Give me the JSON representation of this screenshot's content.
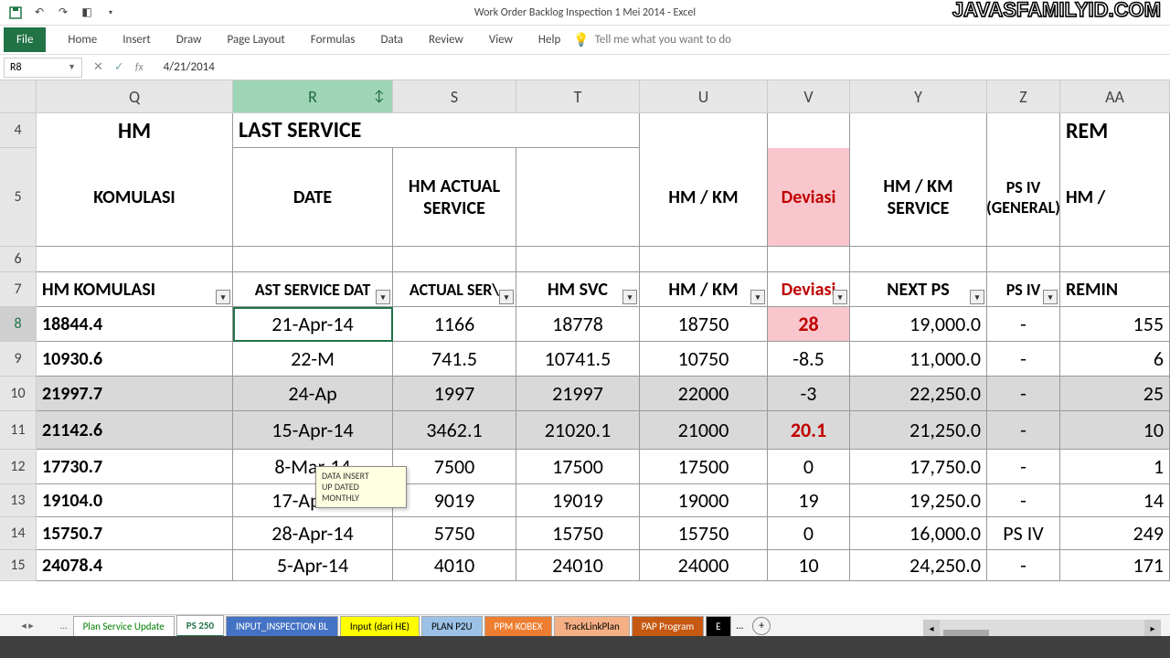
{
  "title": "Work Order Backlog  Inspection 1 Mei  2014  -  Excel",
  "watermark": "JAVASFAMILYID.COM",
  "qat": {
    "save": "save",
    "undo": "undo",
    "redo": "redo",
    "touch": "touch"
  },
  "ribbon": {
    "file": "File",
    "tabs": [
      "Home",
      "Insert",
      "Draw",
      "Page Layout",
      "Formulas",
      "Data",
      "Review",
      "View",
      "Help"
    ],
    "tell": "Tell me what you want to do"
  },
  "formula_bar": {
    "name": "R8",
    "value": "4/21/2014"
  },
  "columns": [
    "Q",
    "R",
    "S",
    "T",
    "U",
    "V",
    "Y",
    "Z",
    "AA"
  ],
  "selected_col_idx": 1,
  "row_heads": [
    "4",
    "5",
    "6",
    "7",
    "8",
    "9",
    "10",
    "11",
    "12",
    "13",
    "14",
    "15"
  ],
  "selected_row_idx": 4,
  "header1": {
    "Q": "HM",
    "R": "LAST SERVICE",
    "AA": "REM"
  },
  "header2": {
    "Q": "KOMULASI",
    "R": "DATE",
    "S": "HM ACTUAL SERVICE",
    "T": "",
    "U": "HM / KM",
    "V": "Deviasi",
    "Y": "HM / KM SERVICE",
    "Z": "PS IV (GENERAL)",
    "AA": "HM /"
  },
  "filter_row": {
    "Q": "HM KOMULASI",
    "R": "AST SERVICE DAT",
    "S": "ACTUAL SER\\",
    "T": "HM SVC",
    "U": "HM / KM",
    "V": "Deviasi",
    "Y": "NEXT PS",
    "Z": "PS IV",
    "AA": "REMIN"
  },
  "data": [
    {
      "Q": "18844.4",
      "R": "21-Apr-14",
      "S": "1166",
      "T": "18778",
      "U": "18750",
      "V": "28",
      "Vred": true,
      "Y": "19,000.0",
      "Z": "-",
      "AA": "155"
    },
    {
      "Q": "10930.6",
      "R": "22-M",
      "S": "741.5",
      "T": "10741.5",
      "U": "10750",
      "V": "-8.5",
      "Y": "11,000.0",
      "Z": "-",
      "AA": "6"
    },
    {
      "Q": "21997.7",
      "R": "24-Ap",
      "S": "1997",
      "T": "21997",
      "U": "22000",
      "V": "-3",
      "Y": "22,250.0",
      "Z": "-",
      "AA": "25",
      "gray": true
    },
    {
      "Q": "21142.6",
      "R": "15-Apr-14",
      "S": "3462.1",
      "T": "21020.1",
      "U": "21000",
      "V": "20.1",
      "Vred": true,
      "Y": "21,250.0",
      "Z": "-",
      "AA": "10",
      "gray": true
    },
    {
      "Q": "17730.7",
      "R": "8-Mar-14",
      "S": "7500",
      "T": "17500",
      "U": "17500",
      "V": "0",
      "Y": "17,750.0",
      "Z": "-",
      "AA": "1"
    },
    {
      "Q": "19104.0",
      "R": "17-Apr-14",
      "S": "9019",
      "T": "19019",
      "U": "19000",
      "V": "19",
      "Y": "19,250.0",
      "Z": "-",
      "AA": "14"
    },
    {
      "Q": "15750.7",
      "R": "28-Apr-14",
      "S": "5750",
      "T": "15750",
      "U": "15750",
      "V": "0",
      "Y": "16,000.0",
      "Z": "PS IV",
      "AA": "249"
    },
    {
      "Q": "24078.4",
      "R": "5-Apr-14",
      "S": "4010",
      "T": "24010",
      "U": "24000",
      "V": "10",
      "Y": "24,250.0",
      "Z": "-",
      "AA": "171"
    }
  ],
  "comment": {
    "l1": "DATA INSERT",
    "l2": "UP DATED",
    "l3": "MONTHLY"
  },
  "sheets": [
    {
      "name": "Plan Service Update",
      "cls": "green"
    },
    {
      "name": "PS 250",
      "cls": "active"
    },
    {
      "name": "INPUT_INSPECTION BL",
      "cls": "blue"
    },
    {
      "name": "Input (dari HE)",
      "cls": "yellow"
    },
    {
      "name": "PLAN P2U",
      "cls": "lblue"
    },
    {
      "name": "PPM KOBEX",
      "cls": "orange"
    },
    {
      "name": "TrackLinkPlan",
      "cls": "orange2"
    },
    {
      "name": "PAP Program",
      "cls": "brown"
    },
    {
      "name": "E",
      "cls": "black"
    }
  ]
}
